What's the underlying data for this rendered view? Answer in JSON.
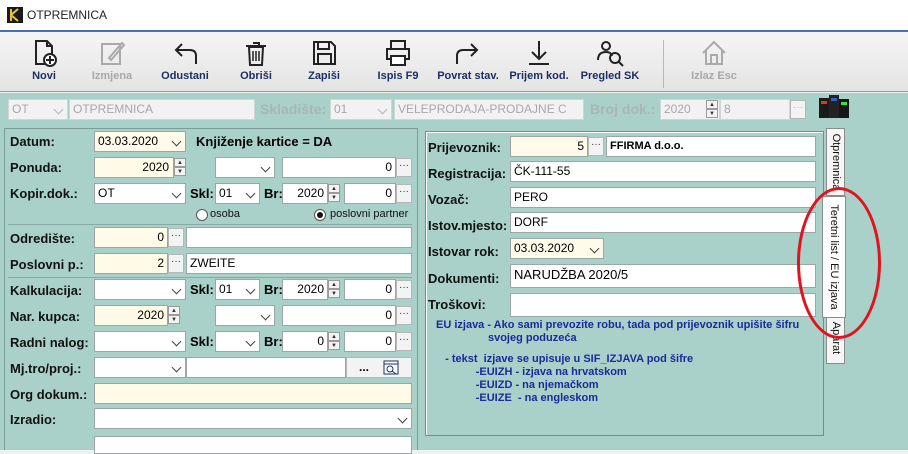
{
  "window": {
    "title": "OTPREMNICA"
  },
  "toolbar": {
    "buttons": [
      {
        "key": "novi",
        "label": "Novi",
        "icon": "new-document-icon",
        "enabled": true
      },
      {
        "key": "izmjena",
        "label": "Izmjena",
        "icon": "edit-icon",
        "enabled": false
      },
      {
        "key": "odustani",
        "label": "Odustani",
        "icon": "undo-icon",
        "enabled": true
      },
      {
        "key": "obrisi",
        "label": "Obriši",
        "icon": "trash-icon",
        "enabled": true
      },
      {
        "key": "zapisi",
        "label": "Zapiši",
        "icon": "save-icon",
        "enabled": true
      },
      {
        "key": "ispis",
        "label": "Ispis F9",
        "icon": "print-icon",
        "enabled": true
      },
      {
        "key": "povrat",
        "label": "Povrat stav.",
        "icon": "forward-arrow-icon",
        "enabled": true
      },
      {
        "key": "prijem",
        "label": "Prijem kod.",
        "icon": "download-arrow-icon",
        "enabled": true
      },
      {
        "key": "pregled",
        "label": "Pregled SK",
        "icon": "users-search-icon",
        "enabled": true
      },
      {
        "key": "izlaz",
        "label": "Izlaz Esc",
        "icon": "home-icon",
        "enabled": false
      }
    ]
  },
  "header": {
    "doc_type": "OT",
    "doc_name": "OTPREMNICA",
    "skladiste_label": "Skladište:",
    "skladiste_code": "01",
    "skladiste_name": "VELEPRODAJA-PRODAJNE C",
    "broj_label": "Broj dok.:",
    "broj_year": "2020",
    "broj_num": "8"
  },
  "left": {
    "datum_label": "Datum:",
    "datum_value": "03.03.2020",
    "knjizenje": "Knjiženje kartice = DA",
    "ponuda_label": "Ponuda:",
    "ponuda_year": "2020",
    "ponuda_num": "0",
    "kopir_label": "Kopir.dok.:",
    "kopir_value": "OT",
    "skl_label": "Skl:",
    "kopir_skl": "01",
    "br_label": "Br:",
    "kopir_year": "2020",
    "kopir_num": "0",
    "radio_osoba": "osoba",
    "radio_partner": "poslovni partner",
    "odrediste_label": "Odredište:",
    "odrediste_num": "0",
    "odrediste_name": "",
    "poslovni_label": "Poslovni p.:",
    "poslovni_num": "2",
    "poslovni_name": "ZWEITE",
    "kalk_label": "Kalkulacija:",
    "kalk_skl": "01",
    "kalk_year": "2020",
    "kalk_num": "0",
    "narkupca_label": "Nar. kupca:",
    "narkupca_year": "2020",
    "narkupca_num": "0",
    "radni_label": "Radni nalog:",
    "radni_year": "0",
    "radni_num": "0",
    "mjtro_label": "Mj.tro/proj.:",
    "mjtro_btn": "...",
    "org_label": "Org dokum.:",
    "izradio_label": "Izradio:"
  },
  "right": {
    "prijevoznik_label": "Prijevoznik:",
    "prijevoznik_num": "5",
    "prijevoznik_name": "FFIRMA d.o.o.",
    "registracija_label": "Registracija:",
    "registracija_value": "ČK-111-55",
    "vozac_label": "Vozač:",
    "vozac_value": "PERO",
    "istov_mjesto_label": "Istov.mjesto:",
    "istov_mjesto_value": "DORF",
    "istovar_label": "Istovar rok:",
    "istovar_value": "03.03.2020",
    "dokumenti_label": "Dokumenti:",
    "dokumenti_value": "NARUDŽBA 2020/5",
    "troskovi_label": "Troškovi:",
    "troskovi_value": "",
    "eu_lines": [
      "EU izjava - Ako sami prevozite robu, tada pod prijevoznik upišite šifru",
      "                 svojeg poduzeća",
      "",
      "   - tekst  izjave se upisuje u SIF_IZJAVA pod šifre",
      "             -EUIZH - izjava na hrvatskom",
      "             -EUIZD - na njemačkom",
      "             -EUIZE  - na engleskom"
    ]
  },
  "tabs": {
    "otpremnica": "Otpremnica",
    "teretni": "Teretni list / EU izjava",
    "aparat": "Aparat"
  },
  "colors": {
    "panel": "#a9d1ca",
    "accent": "#1b2f64",
    "annotation": "#e0141e"
  }
}
